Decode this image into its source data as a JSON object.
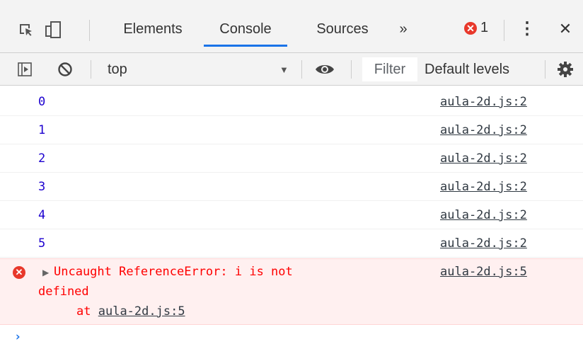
{
  "tabbar": {
    "tabs": [
      {
        "label": "Elements"
      },
      {
        "label": "Console"
      },
      {
        "label": "Sources"
      }
    ],
    "more_tabs_glyph": "»",
    "error_count": "1",
    "menu_glyph": "⋮",
    "close_glyph": "✕",
    "icons": [
      "inspect-element-icon",
      "device-toolbar-icon",
      "error-icon",
      "kebab-menu-icon",
      "close-icon"
    ]
  },
  "toolbar": {
    "context": "top",
    "filter_placeholder": "Filter",
    "levels": "Default levels",
    "icons": [
      "sidebar-toggle-icon",
      "clear-console-icon",
      "dropdown-arrow-icon",
      "eye-icon",
      "gear-icon"
    ]
  },
  "console": {
    "messages": [
      {
        "value": "0",
        "source": "aula-2d.js:2"
      },
      {
        "value": "1",
        "source": "aula-2d.js:2"
      },
      {
        "value": "2",
        "source": "aula-2d.js:2"
      },
      {
        "value": "3",
        "source": "aula-2d.js:2"
      },
      {
        "value": "4",
        "source": "aula-2d.js:2"
      },
      {
        "value": "5",
        "source": "aula-2d.js:2"
      }
    ],
    "error": {
      "line1": "Uncaught ReferenceError: i is not",
      "line2": "defined",
      "at_text": "at",
      "at_link": "aula-2d.js:5",
      "source": "aula-2d.js:5"
    },
    "prompt": "›"
  },
  "colors": {
    "accent": "#1a73e8",
    "error_red": "#e8382b",
    "value_blue": "#1c00cf",
    "error_bg": "#fff0f0"
  }
}
